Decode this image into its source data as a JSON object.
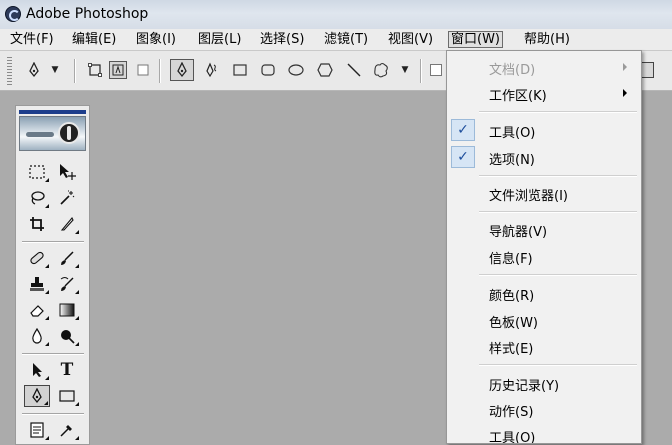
{
  "window": {
    "title": "Adobe Photoshop"
  },
  "menubar": {
    "items": [
      {
        "label": "文件(F)"
      },
      {
        "label": "编辑(E)"
      },
      {
        "label": "图象(I)"
      },
      {
        "label": "图层(L)"
      },
      {
        "label": "选择(S)"
      },
      {
        "label": "滤镜(T)"
      },
      {
        "label": "视图(V)"
      },
      {
        "label": "窗口(W)",
        "active": true
      },
      {
        "label": "帮助(H)"
      }
    ]
  },
  "window_menu": {
    "items": [
      {
        "label": "文档(D)",
        "disabled": true,
        "submenu": true
      },
      {
        "label": "工作区(K)",
        "submenu": true
      },
      {
        "label": "工具(O)",
        "checked": true
      },
      {
        "label": "选项(N)",
        "checked": true
      },
      {
        "label": "文件浏览器(I)"
      },
      {
        "label": "导航器(V)"
      },
      {
        "label": "信息(F)"
      },
      {
        "label": "颜色(R)"
      },
      {
        "label": "色板(W)"
      },
      {
        "label": "样式(E)"
      },
      {
        "label": "历史记录(Y)"
      },
      {
        "label": "动作(S)"
      },
      {
        "label": "工具(O)"
      }
    ],
    "check_glyph": "✓"
  },
  "options_bar": {
    "icons": [
      "pen-tool-icon",
      "shape-layers-icon",
      "paths-icon",
      "fill-pixels-icon",
      "pen-icon",
      "freeform-pen-icon",
      "rectangle-icon",
      "rounded-rectangle-icon",
      "ellipse-icon",
      "polygon-icon",
      "line-icon",
      "custom-shape-icon"
    ]
  },
  "toolbox": {
    "tools": [
      "marquee-tool-icon",
      "move-tool-icon",
      "lasso-tool-icon",
      "magic-wand-tool-icon",
      "crop-tool-icon",
      "slice-tool-icon",
      "healing-brush-tool-icon",
      "brush-tool-icon",
      "clone-stamp-tool-icon",
      "history-brush-tool-icon",
      "eraser-tool-icon",
      "gradient-tool-icon",
      "blur-tool-icon",
      "dodge-tool-icon",
      "path-selection-tool-icon",
      "type-tool-icon",
      "pen-tool-icon",
      "rectangle-tool-icon",
      "notes-tool-icon",
      "eyedropper-tool-icon"
    ],
    "type_glyph": "T"
  },
  "colors": {
    "canvas": "#ababab",
    "menu_bg": "#f1f1f1",
    "check": "#1e4e9c"
  }
}
